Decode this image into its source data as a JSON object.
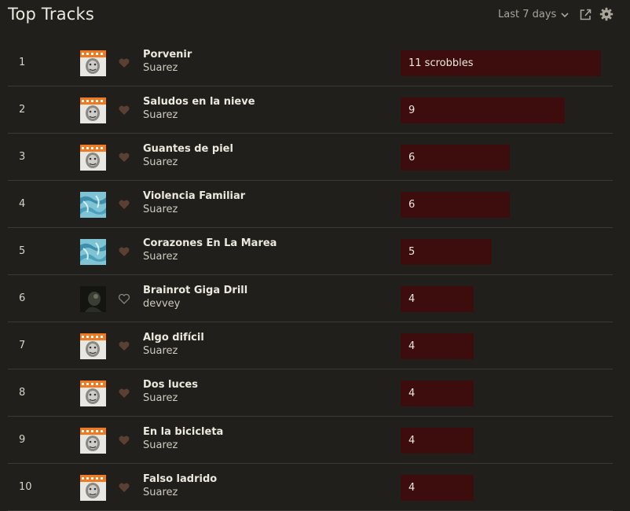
{
  "header": {
    "title": "Top Tracks",
    "period_label": "Last 7 days"
  },
  "bar_max_value": 11,
  "colors": {
    "background": "#201f1b",
    "bar": "#3d0d0d",
    "heart_loved": "#5a3f33",
    "heart_outline": "#8a8478"
  },
  "tracks": [
    {
      "rank": "1",
      "name": "Porvenir",
      "artist": "Suarez",
      "scrobbles": 11,
      "scrobbles_label": "11 scrobbles",
      "art": "suarez-album-cover",
      "loved": true
    },
    {
      "rank": "2",
      "name": "Saludos en la nieve",
      "artist": "Suarez",
      "scrobbles": 9,
      "scrobbles_label": "9",
      "art": "suarez-album-cover",
      "loved": true
    },
    {
      "rank": "3",
      "name": "Guantes de piel",
      "artist": "Suarez",
      "scrobbles": 6,
      "scrobbles_label": "6",
      "art": "suarez-album-cover",
      "loved": true
    },
    {
      "rank": "4",
      "name": "Violencia Familiar",
      "artist": "Suarez",
      "scrobbles": 6,
      "scrobbles_label": "6",
      "art": "blue-water-cover",
      "loved": true
    },
    {
      "rank": "5",
      "name": "Corazones En La Marea",
      "artist": "Suarez",
      "scrobbles": 5,
      "scrobbles_label": "5",
      "art": "blue-water-cover",
      "loved": true
    },
    {
      "rank": "6",
      "name": "Brainrot Giga Drill",
      "artist": "devvey",
      "scrobbles": 4,
      "scrobbles_label": "4",
      "art": "dark-cover",
      "loved": false
    },
    {
      "rank": "7",
      "name": "Algo difícil",
      "artist": "Suarez",
      "scrobbles": 4,
      "scrobbles_label": "4",
      "art": "suarez-album-cover",
      "loved": true
    },
    {
      "rank": "8",
      "name": "Dos luces",
      "artist": "Suarez",
      "scrobbles": 4,
      "scrobbles_label": "4",
      "art": "suarez-album-cover",
      "loved": true
    },
    {
      "rank": "9",
      "name": "En la bicicleta",
      "artist": "Suarez",
      "scrobbles": 4,
      "scrobbles_label": "4",
      "art": "suarez-album-cover",
      "loved": true
    },
    {
      "rank": "10",
      "name": "Falso ladrido",
      "artist": "Suarez",
      "scrobbles": 4,
      "scrobbles_label": "4",
      "art": "suarez-album-cover",
      "loved": true
    }
  ]
}
